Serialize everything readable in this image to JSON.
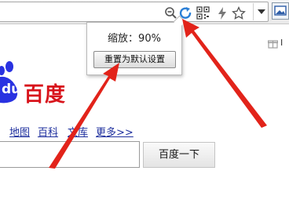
{
  "toolbar": {
    "icons": [
      "zoom-out-icon",
      "refresh-icon",
      "qr-code-icon",
      "lightning-icon",
      "star-icon"
    ],
    "dropdown_icon": "chevron-down-icon"
  },
  "bookmarks": {
    "partial_label": "I"
  },
  "zoom_popup": {
    "label": "缩放：90%",
    "reset_button": "重置为默认设置"
  },
  "logo": {
    "paw_letters": "du",
    "text": "百度",
    "color": "#d8131b"
  },
  "nav": {
    "links": [
      "地图",
      "百科",
      "文库",
      "更多>>"
    ]
  },
  "search": {
    "button": "百度一下",
    "value": ""
  },
  "annotation": {
    "arrow_color": "#e2231a"
  }
}
